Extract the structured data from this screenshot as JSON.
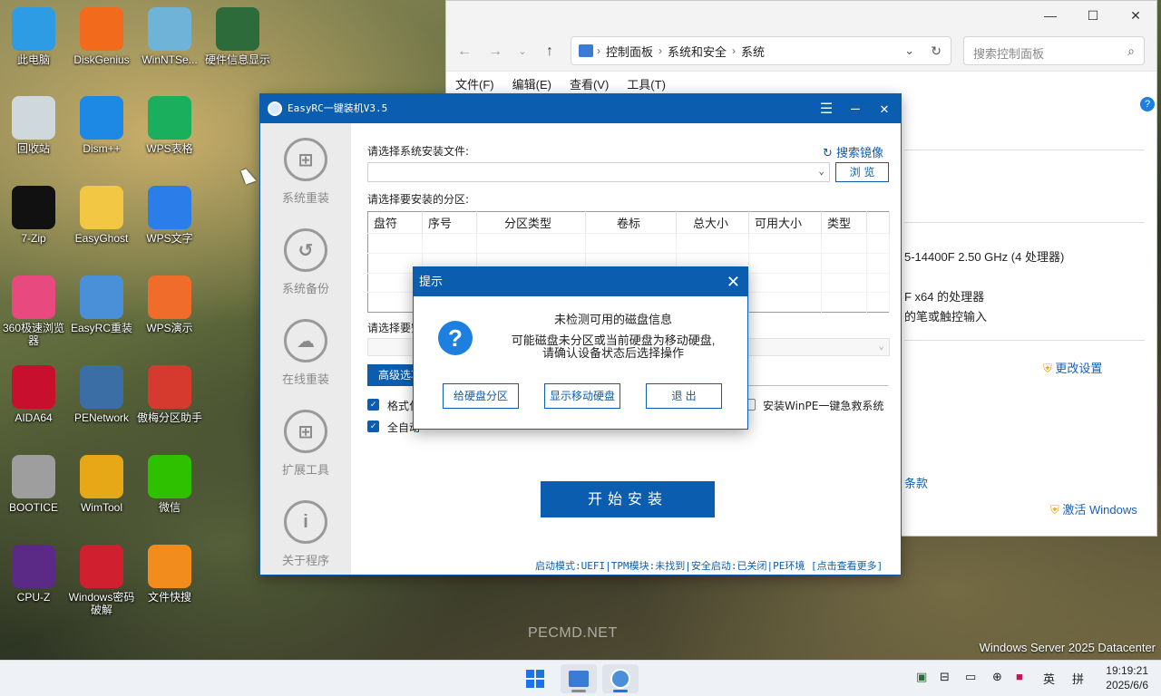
{
  "desktop": {
    "icons": [
      {
        "label": "此电脑",
        "icon": "computer-icon",
        "color": "#2e9be5"
      },
      {
        "label": "DiskGenius",
        "icon": "diskgenius-icon",
        "color": "#f26b1d"
      },
      {
        "label": "WinNTSe...",
        "icon": "winntsetup-icon",
        "color": "#6fb3d9"
      },
      {
        "label": "硬件信息显示",
        "icon": "hardware-info-icon",
        "color": "#2d6b3a"
      },
      {
        "label": "回收站",
        "icon": "recycle-bin-icon",
        "color": "#cfd8dc"
      },
      {
        "label": "Dism++",
        "icon": "dism-icon",
        "color": "#1e88e5"
      },
      {
        "label": "WPS表格",
        "icon": "wps-sheet-icon",
        "color": "#1aaf5d"
      },
      {
        "label": "7-Zip",
        "icon": "7zip-icon",
        "color": "#111111"
      },
      {
        "label": "EasyGhost",
        "icon": "easyghost-icon",
        "color": "#f2c744"
      },
      {
        "label": "WPS文字",
        "icon": "wps-writer-icon",
        "color": "#2b7de9"
      },
      {
        "label": "360极速浏览器",
        "icon": "360-browser-icon",
        "color": "#e84a7f"
      },
      {
        "label": "EasyRC重装",
        "icon": "easyrc-icon",
        "color": "#4a90d9"
      },
      {
        "label": "WPS演示",
        "icon": "wps-slides-icon",
        "color": "#ef6c2a"
      },
      {
        "label": "AIDA64",
        "icon": "aida64-icon",
        "color": "#c8102e"
      },
      {
        "label": "PENetwork",
        "icon": "penetwork-icon",
        "color": "#3a6ea5"
      },
      {
        "label": "傲梅分区助手",
        "icon": "aomei-partition-icon",
        "color": "#d63a2f"
      },
      {
        "label": "BOOTICE",
        "icon": "bootice-icon",
        "color": "#9e9e9e"
      },
      {
        "label": "WimTool",
        "icon": "wimtool-icon",
        "color": "#e6a817"
      },
      {
        "label": "微信",
        "icon": "wechat-icon",
        "color": "#2dc100"
      },
      {
        "label": "CPU-Z",
        "icon": "cpuz-icon",
        "color": "#5b2a86"
      },
      {
        "label": "Windows密码破解",
        "icon": "password-crack-icon",
        "color": "#d01f2e"
      },
      {
        "label": "文件快搜",
        "icon": "file-search-icon",
        "color": "#f28c1d"
      }
    ],
    "watermark": "PECMD.NET",
    "os_label": "Windows Server 2025 Datacenter"
  },
  "explorer": {
    "breadcrumbs": [
      "控制面板",
      "系统和安全",
      "系统"
    ],
    "search_placeholder": "搜索控制面板",
    "menu": [
      "文件(F)",
      "编辑(E)",
      "查看(V)",
      "工具(T)"
    ],
    "cpu_text": "5-14400F   2.50 GHz  (4 处理器)",
    "arch_text": "F x64 的处理器",
    "pen_text": "的笔或触控输入",
    "change_settings": "更改设置",
    "terms": "条款",
    "activate": "激活 Windows"
  },
  "easyrc": {
    "title": "EasyRC一键装机V3.5",
    "sidebar": [
      "系统重装",
      "系统备份",
      "在线重装",
      "扩展工具",
      "关于程序"
    ],
    "select_file_label": "请选择系统安装文件:",
    "search_mirror": "搜索镜像",
    "browse": "浏 览",
    "select_partition_label": "请选择要安装的分区:",
    "table_headers": [
      "盘符",
      "序号",
      "分区类型",
      "卷标",
      "总大小",
      "可用大小",
      "类型"
    ],
    "select2_label": "请选择要安",
    "adv_tab": "高级选项",
    "opt_format": "格式化",
    "opt_auto": "全自动",
    "opt_winpe": "安装WinPE一键急救系统",
    "start": "开始安装",
    "status": "启动模式:UEFI|TPM模块:未找到|安全启动:已关闭|PE环境 [点击查看更多]"
  },
  "dialog": {
    "title": "提示",
    "message_title": "未检测可用的磁盘信息",
    "message_line1": "可能磁盘未分区或当前硬盘为移动硬盘,",
    "message_line2": "请确认设备状态后选择操作",
    "btn_partition": "给硬盘分区",
    "btn_show_removable": "显示移动硬盘",
    "btn_exit": "退 出"
  },
  "taskbar": {
    "ime_lang": "英",
    "ime_mode": "拼",
    "time": "19:19:21",
    "date": "2025/6/6"
  },
  "colors": {
    "accent": "#0b5eaf"
  }
}
